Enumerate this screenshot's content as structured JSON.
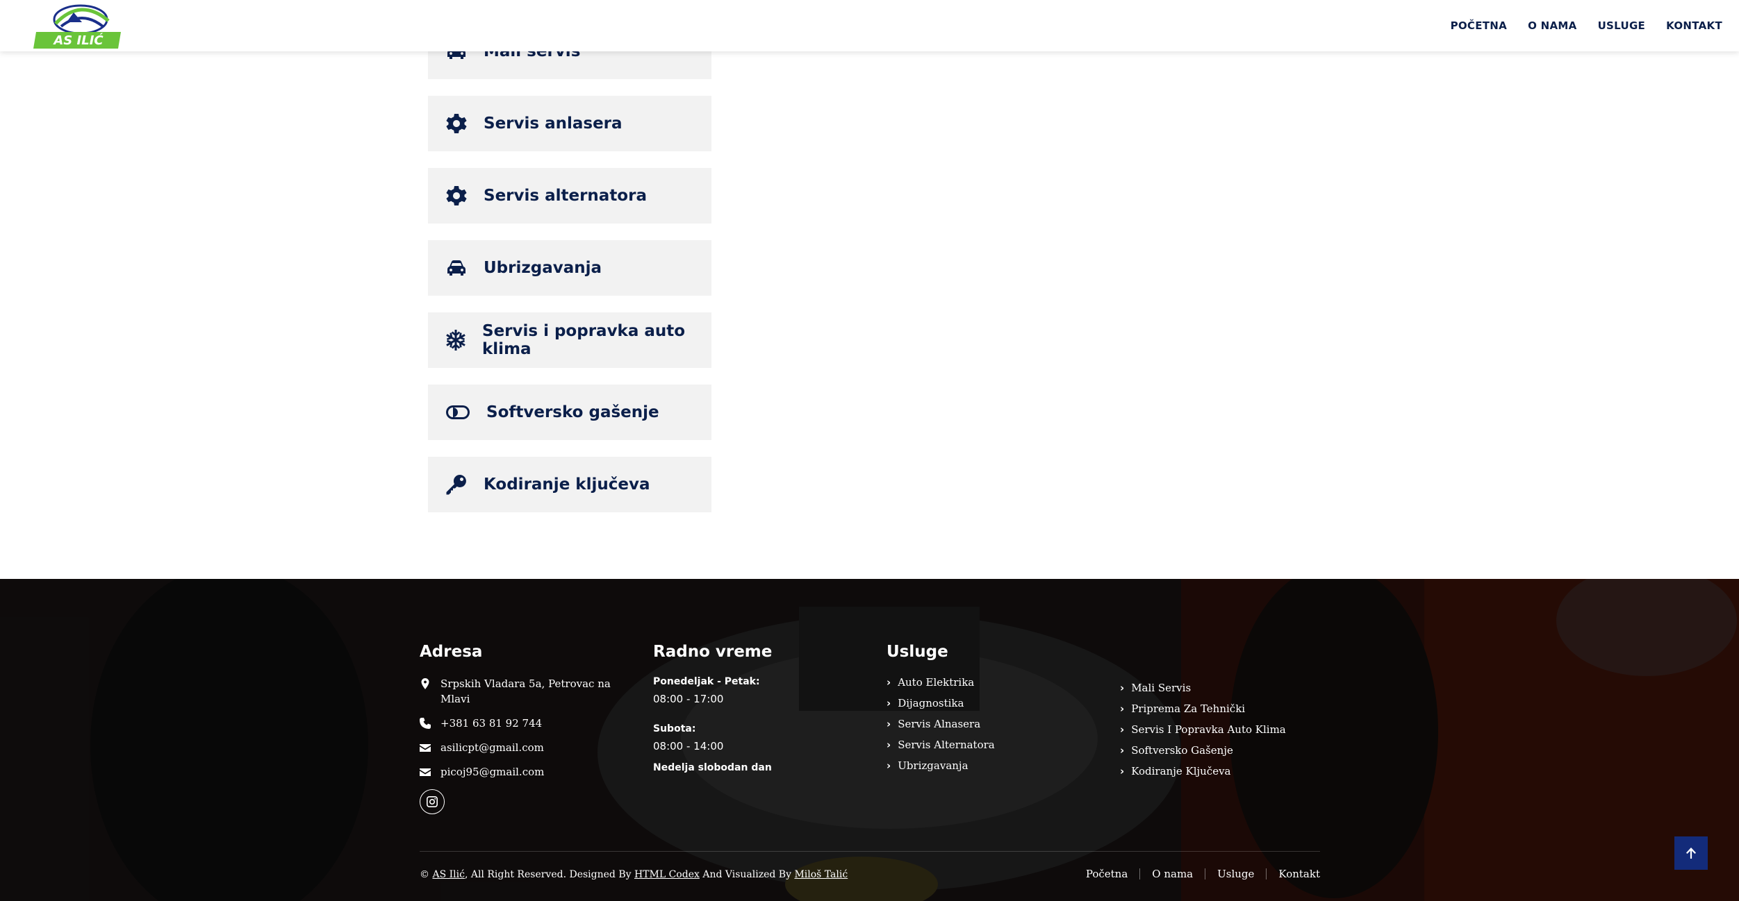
{
  "header": {
    "logo_text": "AS ILIĆ",
    "nav": [
      "POČETNA",
      "O NAMA",
      "USLUGE",
      "KONTAKT"
    ]
  },
  "services": [
    {
      "label": "Mali servis",
      "icon": "car-icon"
    },
    {
      "label": "Servis anlasera",
      "icon": "gear-icon"
    },
    {
      "label": "Servis alternatora",
      "icon": "gear-icon"
    },
    {
      "label": "Ubrizgavanja",
      "icon": "car-icon"
    },
    {
      "label": "Servis i popravka auto klima",
      "icon": "snowflake-icon"
    },
    {
      "label": "Softversko gašenje",
      "icon": "toggle-icon"
    },
    {
      "label": "Kodiranje ključeva",
      "icon": "key-icon"
    }
  ],
  "footer": {
    "address": {
      "title": "Adresa",
      "street": "Srpskih Vladara 5a, Petrovac na Mlavi",
      "phone": "+381 63 81 92 744",
      "email1": "asilicpt@gmail.com",
      "email2": "picoj95@gmail.com"
    },
    "hours": {
      "title": "Radno vreme",
      "weekday_label": "Ponedeljak - Petak:",
      "weekday_value": "08:00 - 17:00",
      "saturday_label": "Subota:",
      "saturday_value": "08:00 - 14:00",
      "sunday": "Nedelja slobodan dan"
    },
    "services": {
      "title": "Usluge",
      "col1": [
        "Auto Elektrika",
        "Dijagnostika",
        "Servis Alnasera",
        "Servis Alternatora",
        "Ubrizgavanja"
      ],
      "col2": [
        "Mali Servis",
        "Priprema Za Tehnički",
        "Servis I Popravka Auto Klima",
        "Softversko Gašenje",
        "Kodiranje Ključeva"
      ]
    },
    "copyright": {
      "prefix": "© ",
      "brand": "AS Ilić",
      "middle": ", All Right Reserved. Designed By ",
      "designer": "HTML Codex",
      "and": " And Visualized By ",
      "visualizer": "Miloš Talić"
    },
    "nav": [
      "Početna",
      "O nama",
      "Usluge",
      "Kontakt"
    ]
  }
}
